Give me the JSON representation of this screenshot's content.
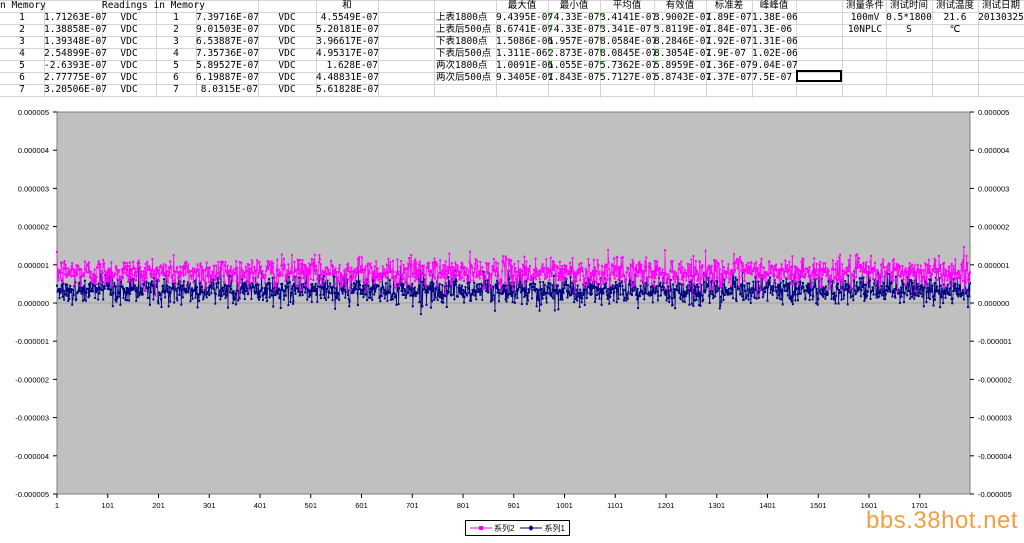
{
  "sheet": {
    "header_left_a": "n Memory",
    "header_left_b": "Readings in Memory",
    "header_sum": "和",
    "rows": [
      {
        "n": "1",
        "a": "1.71263E-07",
        "u1": "VDC",
        "n2": "1",
        "b": "7.39716E-07",
        "u2": "VDC",
        "sum": "4.5549E-07"
      },
      {
        "n": "2",
        "a": "1.38858E-07",
        "u1": "VDC",
        "n2": "2",
        "b": "9.01503E-07",
        "u2": "VDC",
        "sum": "5.20181E-07"
      },
      {
        "n": "3",
        "a": "1.39348E-07",
        "u1": "VDC",
        "n2": "3",
        "b": "6.53887E-07",
        "u2": "VDC",
        "sum": "3.96617E-07"
      },
      {
        "n": "4",
        "a": "2.54899E-07",
        "u1": "VDC",
        "n2": "4",
        "b": "7.35736E-07",
        "u2": "VDC",
        "sum": "4.95317E-07"
      },
      {
        "n": "5",
        "a": "-2.6393E-07",
        "u1": "VDC",
        "n2": "5",
        "b": "5.89527E-07",
        "u2": "VDC",
        "sum": "1.628E-07"
      },
      {
        "n": "6",
        "a": "2.77775E-07",
        "u1": "VDC",
        "n2": "6",
        "b": "6.19887E-07",
        "u2": "VDC",
        "sum": "4.48831E-07"
      },
      {
        "n": "7",
        "a": "3.20506E-07",
        "u1": "VDC",
        "n2": "7",
        "b": "8.0315E-07",
        "u2": "VDC",
        "sum": "5.61828E-07"
      }
    ],
    "stats_headers": [
      "最大值",
      "最小值",
      "平均值",
      "有效值",
      "标准差",
      "峰峰值"
    ],
    "stats_rows": [
      {
        "label": "上表1800点",
        "v": [
          "9.4395E-07",
          "-4.33E-07",
          "3.4141E-07",
          "3.9002E-07",
          "1.89E-07",
          "1.38E-06"
        ]
      },
      {
        "label": "上表后500点",
        "v": [
          "8.6741E-07",
          "-4.33E-07",
          "3.341E-07",
          "3.8119E-07",
          "1.84E-07",
          "1.3E-06"
        ]
      },
      {
        "label": "下表1800点",
        "v": [
          "1.5086E-06",
          "1.957E-07",
          "8.0584E-07",
          "8.2846E-07",
          "1.92E-07",
          "1.31E-06"
        ]
      },
      {
        "label": "下表后500点",
        "v": [
          "1.311E-06",
          "2.873E-07",
          "8.0845E-07",
          "8.3054E-07",
          "1.9E-07",
          "1.02E-06"
        ]
      },
      {
        "label": "两次1800点",
        "v": [
          "1.0091E-06",
          "1.055E-07",
          "5.7362E-07",
          "5.8959E-07",
          "1.36E-07",
          "9.04E-07"
        ]
      },
      {
        "label": "两次后500点",
        "v": [
          "9.3405E-07",
          "1.843E-07",
          "5.7127E-07",
          "5.8743E-07",
          "1.37E-07",
          "7.5E-07"
        ]
      }
    ],
    "cond_headers": [
      "测量条件",
      "测试时间",
      "测试温度",
      "测试日期"
    ],
    "cond_row1": [
      "100mV",
      "0.5*1800",
      "21.6",
      "20130325"
    ],
    "cond_row2": [
      "10NPLC",
      "S",
      "℃",
      ""
    ]
  },
  "chart_data": {
    "type": "line",
    "y_ticks": [
      "0.000005",
      "0.000004",
      "0.000003",
      "0.000002",
      "0.000001",
      "0.000000",
      "-0.000001",
      "-0.000002",
      "-0.000003",
      "-0.000004",
      "-0.000005"
    ],
    "x_ticks": [
      "1",
      "101",
      "201",
      "301",
      "401",
      "501",
      "601",
      "701",
      "801",
      "901",
      "1001",
      "1101",
      "1201",
      "1301",
      "1401",
      "1501",
      "1601",
      "1701"
    ],
    "xlim": [
      1,
      1800
    ],
    "ylim": [
      -5e-06,
      5e-06
    ],
    "series": [
      {
        "name": "系列2",
        "color": "#ff00ff",
        "mean": 8.06e-07,
        "std": 1.92e-07,
        "min": 1.957e-07,
        "max": 1.5086e-06,
        "n": 1800
      },
      {
        "name": "系列1",
        "color": "#000080",
        "mean": 3.41e-07,
        "std": 1.89e-07,
        "min": -4.33e-07,
        "max": 9.4395e-07,
        "n": 1800
      }
    ],
    "plot_bg": "#c0c0c0",
    "legend": [
      "系列2",
      "系列1"
    ]
  },
  "watermark": "bbs.38hot.net"
}
